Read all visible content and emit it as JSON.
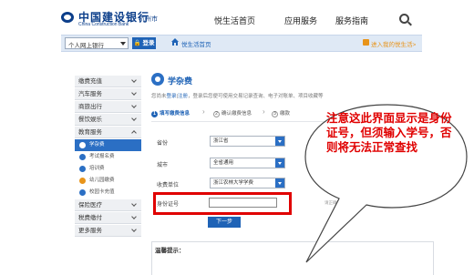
{
  "header": {
    "bank_name_cn": "中国建设银行",
    "bank_name_en": "China Construction Bank",
    "city": "杭州市",
    "nav": [
      "悦生活首页",
      "应用服务",
      "服务指南"
    ]
  },
  "toolbar": {
    "bank_select": "个人网上银行",
    "login": "登录",
    "home": "悦生活首页",
    "user_link": "进入我的悦生活>"
  },
  "sidebar": {
    "items": [
      {
        "label": "缴费充值"
      },
      {
        "label": "汽车服务"
      },
      {
        "label": "商旅出行"
      },
      {
        "label": "餐饮娱乐"
      },
      {
        "label": "教育服务"
      }
    ],
    "sub_items": [
      {
        "label": "学杂费",
        "active": true
      },
      {
        "label": "考试报名费",
        "active": false
      },
      {
        "label": "培训费",
        "active": false
      },
      {
        "label": "幼儿园缴费",
        "active": false
      },
      {
        "label": "校园卡充值",
        "active": false
      }
    ],
    "items_after": [
      {
        "label": "保险医疗"
      },
      {
        "label": "税费缴付"
      },
      {
        "label": "更多服务"
      }
    ]
  },
  "main": {
    "title": "学杂费",
    "notice_prefix": "您尚未",
    "notice_login": "登录",
    "notice_sep": "|",
    "notice_register": "注册",
    "notice_rest": "，登录后您便可使用交易记录查询、电子对账单、项目收藏等",
    "steps": [
      {
        "num": "1",
        "label": "填写缴费信息"
      },
      {
        "num": "2",
        "label": "确认缴费信息"
      },
      {
        "num": "3",
        "label": "缴款"
      }
    ],
    "fields": [
      {
        "label": "省份",
        "value": "浙江省"
      },
      {
        "label": "城市",
        "value": "全省通用"
      },
      {
        "label": "收费单位",
        "value": "浙江农林大学学费"
      }
    ],
    "id_label": "身份证号",
    "hint": "请正确输入身份证号，查询缴费数据。",
    "next": "下一步",
    "tips_title": "温馨提示："
  },
  "annotation": {
    "text": "注意这此界面显示是身份证号，但须输入学号，否则将无法正常查找",
    "color": "#e00000"
  }
}
